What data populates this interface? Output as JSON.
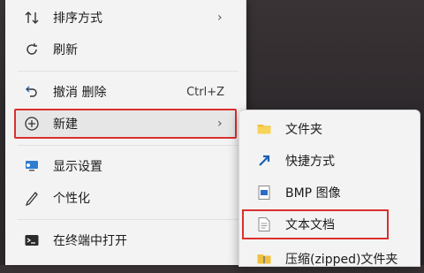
{
  "context_menu": {
    "items": [
      {
        "label": "排序方式",
        "icon": "sort-icon"
      },
      {
        "label": "刷新",
        "icon": "refresh-icon"
      },
      {
        "label": "撤消 删除",
        "shortcut": "Ctrl+Z",
        "icon": "undo-icon"
      },
      {
        "label": "新建",
        "icon": "new-plus-icon"
      },
      {
        "label": "显示设置",
        "icon": "display-settings-icon"
      },
      {
        "label": "个性化",
        "icon": "personalize-pen-icon"
      },
      {
        "label": "在终端中打开",
        "icon": "terminal-icon"
      }
    ]
  },
  "new_submenu": {
    "items": [
      {
        "label": "文件夹",
        "icon": "folder-icon"
      },
      {
        "label": "快捷方式",
        "icon": "shortcut-arrow-icon"
      },
      {
        "label": "BMP 图像",
        "icon": "bmp-image-icon"
      },
      {
        "label": "文本文档",
        "icon": "text-document-icon"
      },
      {
        "label": "压缩(zipped)文件夹",
        "icon": "zip-folder-icon"
      }
    ]
  },
  "colors": {
    "highlight_border": "#d9302f",
    "menu_bg": "#f4f3f3"
  }
}
